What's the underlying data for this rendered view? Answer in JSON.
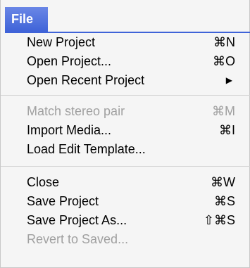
{
  "menu": {
    "title": "File",
    "groups": [
      [
        {
          "label": "New Project",
          "shortcut": "⌘N",
          "enabled": true
        },
        {
          "label": "Open Project...",
          "shortcut": "⌘O",
          "enabled": true
        },
        {
          "label": "Open Recent Project",
          "shortcut": "",
          "submenu_icon": "submenu-arrow-icon",
          "enabled": true
        }
      ],
      [
        {
          "label": "Match stereo pair",
          "shortcut": "⌘M",
          "enabled": false
        },
        {
          "label": "Import Media...",
          "shortcut": "⌘I",
          "enabled": true
        },
        {
          "label": "Load Edit Template...",
          "shortcut": "",
          "enabled": true
        }
      ],
      [
        {
          "label": "Close",
          "shortcut": "⌘W",
          "enabled": true
        },
        {
          "label": "Save Project",
          "shortcut": "⌘S",
          "enabled": true
        },
        {
          "label": "Save Project As...",
          "shortcut": "⇧⌘S",
          "enabled": true
        },
        {
          "label": "Revert to Saved...",
          "shortcut": "",
          "enabled": false
        }
      ]
    ]
  },
  "colors": {
    "highlight": "#3f63d8",
    "disabled_text": "#a0a0a0",
    "menu_background": "#f5f5f5"
  }
}
